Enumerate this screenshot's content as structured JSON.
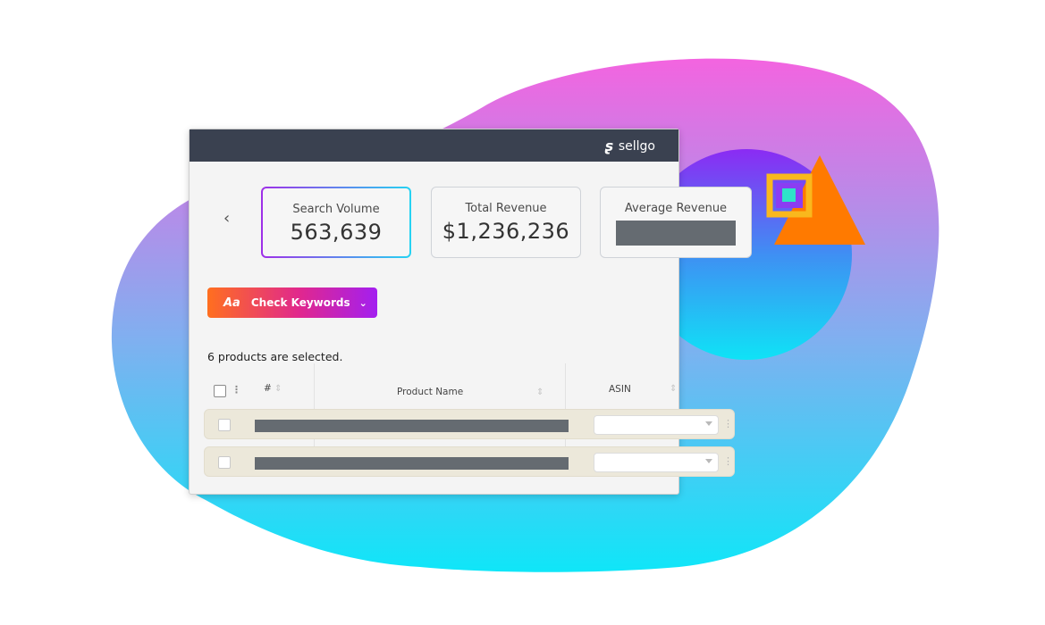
{
  "brand": {
    "name": "sellgo",
    "logo_icon": "s-logo-icon"
  },
  "colors": {
    "titlebar": "#3a4150",
    "blob_top": "#f364e0",
    "blob_bottom": "#0fe6f8",
    "circle_top": "#8b2bf3",
    "circle_bottom": "#0fe3f6",
    "triangle": "#ff7a00",
    "square": "#f9b81d",
    "button_gradient": [
      "#ff6f1f",
      "#e0278f",
      "#a31ff0"
    ]
  },
  "stats": [
    {
      "title": "Search Volume",
      "value": "563,639",
      "active": true
    },
    {
      "title": "Total Revenue",
      "value": "$1,236,236",
      "active": false
    },
    {
      "title": "Average Revenue",
      "value": "",
      "redacted": true
    }
  ],
  "nav": {
    "back_icon": "chevron-left-icon",
    "back_glyph": "‹"
  },
  "action": {
    "icon_text": "Aa",
    "label": "Check Keywords",
    "chevron": "⌄"
  },
  "selection": {
    "text": "6 products are selected."
  },
  "table": {
    "columns": [
      {
        "label": "#"
      },
      {
        "label": "Product Name"
      },
      {
        "label": "ASIN"
      }
    ],
    "rows": [
      {
        "name_redacted": true,
        "asin": ""
      },
      {
        "name_redacted": true,
        "asin": ""
      }
    ]
  }
}
